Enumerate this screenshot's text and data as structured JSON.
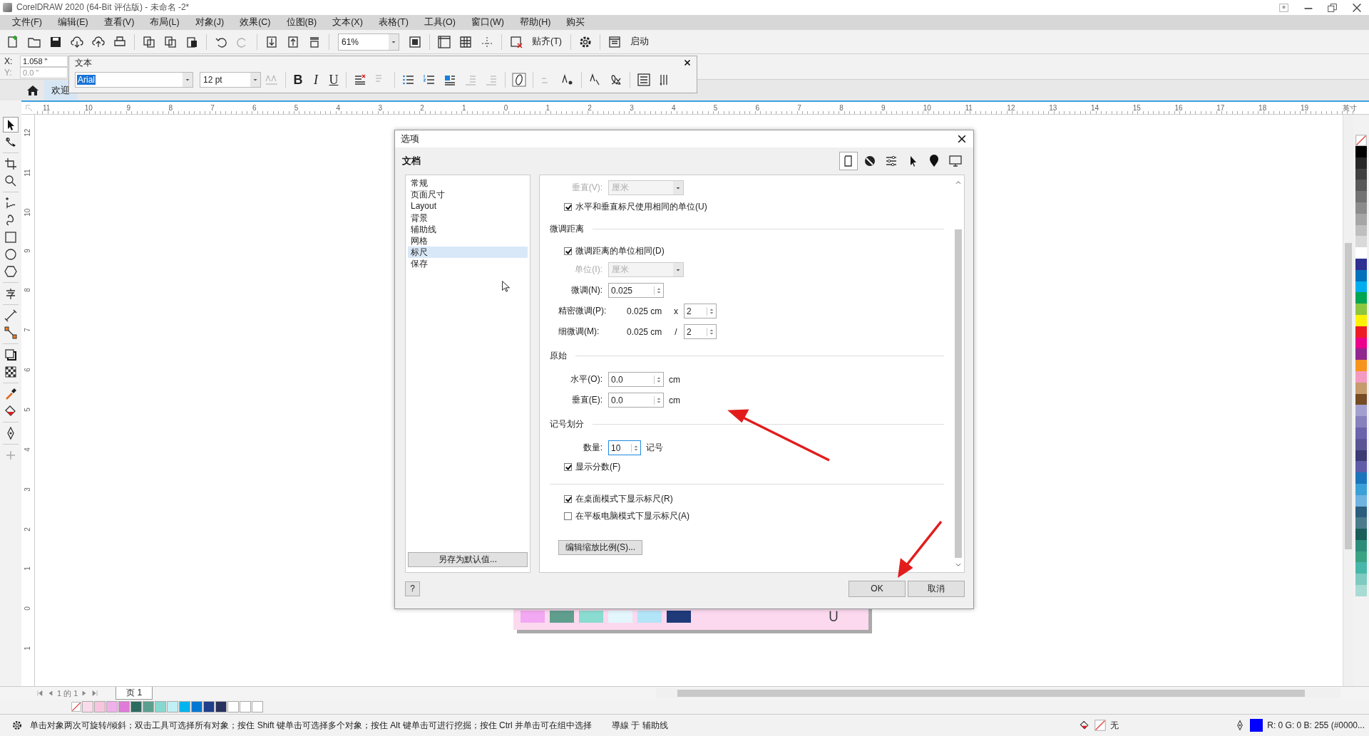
{
  "window": {
    "title": "CorelDRAW 2020 (64-Bit 评估版) - 未命名 -2*"
  },
  "menu": [
    "文件(F)",
    "编辑(E)",
    "查看(V)",
    "布局(L)",
    "对象(J)",
    "效果(C)",
    "位图(B)",
    "文本(X)",
    "表格(T)",
    "工具(O)",
    "窗口(W)",
    "帮助(H)",
    "购买"
  ],
  "toolbar": {
    "zoom": "61%",
    "snap": "贴齐(T)",
    "launch": "启动"
  },
  "position": {
    "x_label": "X:",
    "x": "1.058 \"",
    "y_label": "Y:",
    "y": "0.0 \""
  },
  "text_toolbar": {
    "title": "文本",
    "font": "Arial",
    "size": "12 pt",
    "style_buttons": [
      "B",
      "I",
      "U"
    ]
  },
  "tabs": [
    {
      "label": "欢迎",
      "selected": true
    }
  ],
  "rulers": {
    "horizontal": [
      "11",
      "10",
      "9",
      "8",
      "7",
      "6",
      "5",
      "4",
      "3",
      "2",
      "1",
      "0",
      "1",
      "2",
      "3",
      "4",
      "5",
      "6",
      "7",
      "8",
      "9",
      "10",
      "11",
      "12",
      "13",
      "14",
      "15",
      "16",
      "17",
      "18",
      "19"
    ],
    "unit": "英寸",
    "vertical": [
      "12",
      "11",
      "10",
      "9",
      "8",
      "7",
      "6",
      "5",
      "4",
      "3",
      "2",
      "1",
      "0",
      "1"
    ]
  },
  "page_swatches": [
    {
      "color": "#f2a8f2"
    },
    {
      "color": "#5f9e8c"
    },
    {
      "color": "#8adbd0"
    },
    {
      "color": "#e2f6fb"
    },
    {
      "color": "#b2e5f7"
    },
    {
      "color": "#1f3a78"
    }
  ],
  "dialog": {
    "title": "选项",
    "section": "文档",
    "nav": [
      {
        "label": "常规",
        "selected": false
      },
      {
        "label": "页面尺寸",
        "selected": false
      },
      {
        "label": "Layout",
        "selected": false
      },
      {
        "label": "背景",
        "selected": false
      },
      {
        "label": "辅助线",
        "selected": false
      },
      {
        "label": "网格",
        "selected": false
      },
      {
        "label": "标尺",
        "selected": true
      },
      {
        "label": "保存",
        "selected": false
      }
    ],
    "save_default": "另存为默认值...",
    "rows": [
      {
        "kind": "dropdown",
        "label": "垂直(V):",
        "value": "厘米",
        "disabled": true
      },
      {
        "kind": "checkbox",
        "label": "水平和垂直标尺使用相同的单位(U)",
        "checked": true
      },
      {
        "kind": "section",
        "label": "微调距离"
      },
      {
        "kind": "checkbox",
        "label": "微调距离的单位相同(D)",
        "checked": true
      },
      {
        "kind": "dropdown",
        "label": "单位(I):",
        "value": "厘米",
        "disabled": true
      },
      {
        "kind": "spin",
        "label": "微调(N):",
        "value": "0.025",
        "focused": false
      },
      {
        "kind": "multi",
        "label": "精密微调(P):",
        "reading": "0.025 cm",
        "op": "x",
        "value": "2"
      },
      {
        "kind": "multi",
        "label": "细微调(M):",
        "reading": "0.025 cm",
        "op": "/",
        "value": "2"
      },
      {
        "kind": "section",
        "label": "原始"
      },
      {
        "kind": "spin",
        "label": "水平(O):",
        "value": "0.0",
        "unit": "cm",
        "focused": false
      },
      {
        "kind": "spin",
        "label": "垂直(E):",
        "value": "0.0",
        "unit": "cm",
        "focused": false
      },
      {
        "kind": "section",
        "label": "记号划分"
      },
      {
        "kind": "spin",
        "label": "数量:",
        "value": "10",
        "unit": "记号",
        "focused": true
      },
      {
        "kind": "checkbox",
        "label": "显示分数(F)",
        "checked": true
      },
      {
        "kind": "divider"
      },
      {
        "kind": "checkbox",
        "label": "在桌面模式下显示标尺(R)",
        "checked": true
      },
      {
        "kind": "checkbox",
        "label": "在平板电脑模式下显示标尺(A)",
        "checked": false
      },
      {
        "kind": "button",
        "label": "编辑缩放比例(S)..."
      }
    ],
    "help": "?",
    "ok": "OK",
    "cancel": "取消"
  },
  "page_nav": {
    "current": "1",
    "of": "的",
    "total": "1",
    "tab": "页 1"
  },
  "palette": [
    {
      "color": "#f9dbe9"
    },
    {
      "color": "#f5c6de"
    },
    {
      "color": "#f0b1ea"
    },
    {
      "color": "#e07ad8"
    },
    {
      "color": "#2e6b5f"
    },
    {
      "color": "#5b9f8f"
    },
    {
      "color": "#86d9cf"
    },
    {
      "color": "#bff0f5"
    },
    {
      "color": "#00b4f0"
    },
    {
      "color": "#0078d4"
    },
    {
      "color": "#1f3f8c"
    },
    {
      "color": "#27325e"
    },
    {
      "color": "#ffffff"
    },
    {
      "color": "#ffffff"
    },
    {
      "color": "#ffffff"
    }
  ],
  "side_palette": [
    {
      "color": "#000000"
    },
    {
      "color": "#262626"
    },
    {
      "color": "#404040"
    },
    {
      "color": "#595959"
    },
    {
      "color": "#737373"
    },
    {
      "color": "#8c8c8c"
    },
    {
      "color": "#a6a6a6"
    },
    {
      "color": "#bfbfbf"
    },
    {
      "color": "#d9d9d9"
    },
    {
      "color": "#ffffff"
    },
    {
      "color": "#2e3192"
    },
    {
      "color": "#0072bc"
    },
    {
      "color": "#00aeef"
    },
    {
      "color": "#00a651"
    },
    {
      "color": "#8dc63f"
    },
    {
      "color": "#fff200"
    },
    {
      "color": "#ed1c24"
    },
    {
      "color": "#ec008c"
    },
    {
      "color": "#92278f"
    },
    {
      "color": "#f7941d"
    },
    {
      "color": "#f49ac1"
    },
    {
      "color": "#c69c6d"
    },
    {
      "color": "#754c24"
    },
    {
      "color": "#a3a0d0"
    },
    {
      "color": "#8781bd"
    },
    {
      "color": "#6b63ab"
    },
    {
      "color": "#5b5596"
    },
    {
      "color": "#3d3b74"
    },
    {
      "color": "#605ca8"
    },
    {
      "color": "#1b75bc"
    },
    {
      "color": "#3ba0d8"
    },
    {
      "color": "#6fb3e0"
    },
    {
      "color": "#2b5d7c"
    },
    {
      "color": "#4a7b8c"
    },
    {
      "color": "#1a5e5a"
    },
    {
      "color": "#2c8c7a"
    },
    {
      "color": "#3aa384"
    },
    {
      "color": "#47b7a9"
    },
    {
      "color": "#7ecac0"
    },
    {
      "color": "#a8dbd3"
    }
  ],
  "status": {
    "hint": "单击对象两次可旋转/倾斜；双击工具可选择所有对象；按住 Shift 键单击可选择多个对象；按住 Alt 键单击可进行挖掘；按住 Ctrl 并单击可在组中选择",
    "snap": "導線 于 辅助线",
    "fill": "无",
    "outline": {
      "color": "#0000ff"
    },
    "color_reading": "R: 0 G: 0 B: 255 (#0000..."
  }
}
